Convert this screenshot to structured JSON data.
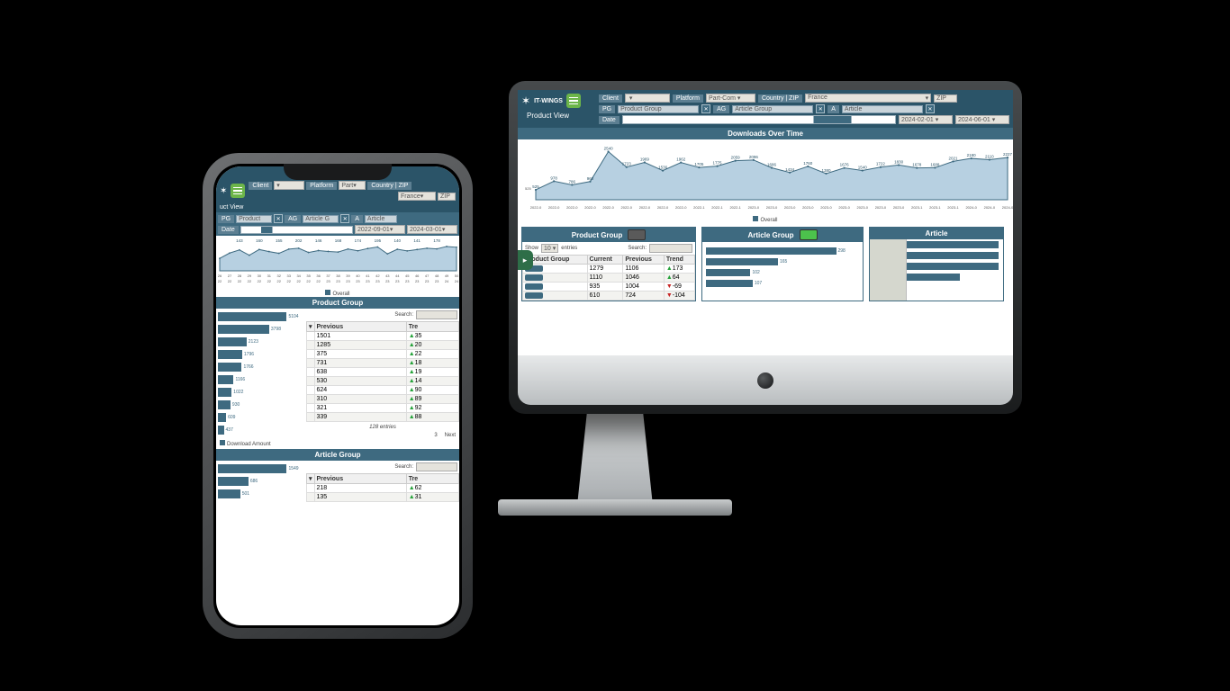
{
  "brand": "IT-WINGS",
  "page_title": "Product View",
  "filters": {
    "client_label": "Client",
    "client_value": "",
    "platform_label": "Platform",
    "platform_value_desktop": "Part-Com",
    "platform_value_phone": "Part",
    "countryzip_label": "Country | ZIP",
    "country_value": "France",
    "zip_placeholder": "ZIP",
    "pg_label": "PG",
    "pg_placeholder": "Product Group",
    "pg_placeholder_phone": "Product",
    "ag_label": "AG",
    "ag_placeholder": "Article Group",
    "ag_placeholder_phone": "Article G",
    "a_label": "A",
    "a_placeholder": "Article",
    "date_label": "Date",
    "date_from_desktop": "2024-02-01",
    "date_to_desktop": "2024-06-01",
    "date_from_phone": "2022-09-01",
    "date_to_phone": "2024-03-01",
    "clear_x": "✕"
  },
  "chart_title": "Downloads Over Time",
  "chart_legend": "Overall",
  "chart_data": {
    "type": "area",
    "xlabel": "",
    "ylabel": "",
    "legend": [
      "Overall"
    ],
    "categories": [
      "2022-0",
      "2022-0",
      "2022-0",
      "2022-0",
      "2022-0",
      "2022-0",
      "2022-0",
      "2022-0",
      "2022-0",
      "2022-1",
      "2022-1",
      "2022-1",
      "2023-0",
      "2023-0",
      "2023-0",
      "2023-0",
      "2023-0",
      "2023-0",
      "2023-0",
      "2023-0",
      "2023-0",
      "2023-1",
      "2023-1",
      "2023-1",
      "2024-0",
      "2024-0",
      "2024-0"
    ],
    "values": [
      525,
      978,
      786,
      960,
      2540,
      1723,
      1969,
      1536,
      1962,
      1705,
      1775,
      2059,
      2096,
      1686,
      1434,
      1760,
      1380,
      1676,
      1540,
      1722,
      1830,
      1678,
      1688,
      2021,
      2180,
      2110,
      2227
    ],
    "ylim": [
      0,
      2800
    ]
  },
  "phone_chart_data": {
    "type": "area",
    "categories": [
      "26",
      "27",
      "28",
      "29",
      "30",
      "31",
      "32",
      "33",
      "34",
      "35",
      "36",
      "37",
      "38",
      "39",
      "40",
      "41",
      "42",
      "43",
      "44",
      "45",
      "46",
      "47",
      "48",
      "49",
      "50"
    ],
    "sub": [
      "22",
      "22",
      "22",
      "22",
      "22",
      "22",
      "22",
      "22",
      "22",
      "22",
      "22",
      "23",
      "23",
      "23",
      "23",
      "23",
      "23",
      "23",
      "23",
      "23",
      "23",
      "23",
      "23",
      "24",
      "24"
    ],
    "values": [
      98,
      140,
      165,
      123,
      168,
      152,
      138,
      171,
      178,
      145,
      160,
      153,
      148,
      172,
      158,
      176,
      188,
      134,
      170,
      157,
      168,
      178,
      173,
      192,
      186
    ],
    "top_labels": [
      143,
      160,
      155,
      202,
      146,
      168,
      174,
      195,
      140,
      141,
      178
    ],
    "legend": [
      "Overall"
    ],
    "ylim": [
      0,
      220
    ]
  },
  "panels": {
    "product_group": "Product Group",
    "article_group": "Article Group",
    "article": "Article"
  },
  "table": {
    "show_label": "Show",
    "show_value": "10",
    "entries_label": "entries",
    "search_label": "Search:",
    "columns": {
      "pg": "Product Group",
      "current": "Current",
      "previous": "Previous",
      "trend": "Trend"
    },
    "rows_desktop": [
      {
        "current": 1279,
        "previous": 1106,
        "trend": 173,
        "dir": "up"
      },
      {
        "current": 1110,
        "previous": 1046,
        "trend": 64,
        "dir": "up"
      },
      {
        "current": 935,
        "previous": 1004,
        "trend": -69,
        "dir": "down"
      },
      {
        "current": 610,
        "previous": 724,
        "trend": -104,
        "dir": "down"
      }
    ],
    "footer_entries_phone": "128 entries",
    "page3": "3",
    "next": "Next",
    "rows_phone": [
      {
        "previous": 1501,
        "trend": "35",
        "dir": "up"
      },
      {
        "previous": 1285,
        "trend": "20",
        "dir": "up"
      },
      {
        "previous": 375,
        "trend": "22",
        "dir": "up"
      },
      {
        "previous": 731,
        "trend": "18",
        "dir": "up"
      },
      {
        "previous": 638,
        "trend": "19",
        "dir": "up"
      },
      {
        "previous": 530,
        "trend": "14",
        "dir": "up"
      },
      {
        "previous": 624,
        "trend": "90",
        "dir": "up"
      },
      {
        "previous": 310,
        "trend": "89",
        "dir": "up"
      },
      {
        "previous": 321,
        "trend": "92",
        "dir": "up"
      },
      {
        "previous": 339,
        "trend": "88",
        "dir": "up"
      }
    ],
    "rows_phone_article": [
      {
        "previous": 218,
        "trend": "62",
        "dir": "up"
      },
      {
        "previous": 135,
        "trend": "31",
        "dir": "up"
      }
    ]
  },
  "pg_bars_phone": {
    "type": "bar",
    "values": [
      5104,
      3798,
      2123,
      1796,
      1766,
      1166,
      1022,
      930,
      609,
      437
    ],
    "legend": "Download Amount"
  },
  "ag_bars_desktop": {
    "type": "bar",
    "values": [
      298,
      165,
      102,
      107
    ]
  },
  "ag_bars_phone": {
    "type": "bar",
    "values": [
      1549,
      686,
      501
    ]
  }
}
